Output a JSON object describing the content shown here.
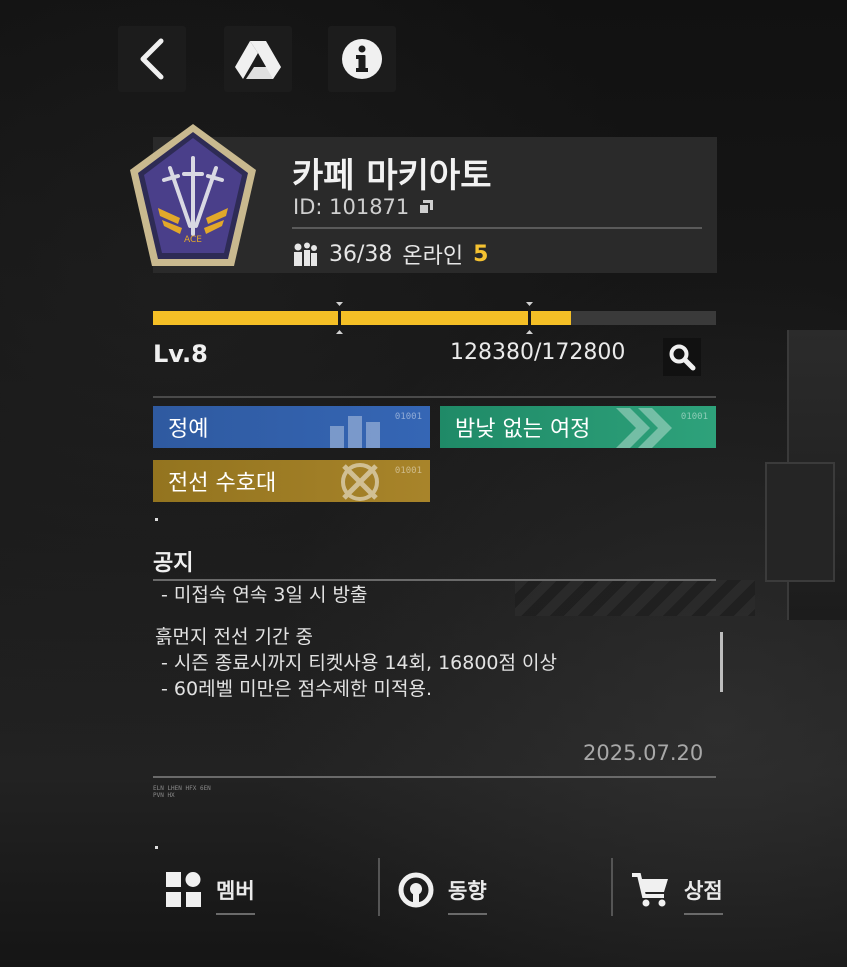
{
  "toolbar": {
    "back_icon": "chevron-left-icon",
    "drive_icon": "google-drive-icon",
    "info_icon": "info-icon"
  },
  "club": {
    "name": "카페 마키아토",
    "id_label": "ID: 101871",
    "members": "36/38",
    "online_label": "온라인",
    "online_count": "5",
    "emblem_text": "ACE"
  },
  "level": {
    "label": "Lv.8",
    "xp_text": "128380/172800",
    "progress": 0.743
  },
  "tags": [
    {
      "label": "정예",
      "code": "01001",
      "color": "#3566b5"
    },
    {
      "label": "밤낮 없는 여정",
      "code": "01001",
      "color": "#2ea27b"
    },
    {
      "label": "전선 수호대",
      "code": "01001",
      "color": "#a8842a"
    }
  ],
  "notice": {
    "title": "공지",
    "lines": [
      " - 미접속 연속 3일 시 방출",
      "",
      "흙먼지 전선 기간 중",
      " - 시즌 종료시까지 티켓사용 14회, 16800점 이상",
      " - 60레벨 미만은 점수제한 미적용."
    ],
    "date": "2025.07.20",
    "tiny_code": "ELN LHEN HFX 6EN\nPVN HX"
  },
  "nav": [
    {
      "label": "멤버",
      "icon": "members-grid-icon"
    },
    {
      "label": "동향",
      "icon": "trend-icon"
    },
    {
      "label": "상점",
      "icon": "shopping-cart-icon"
    }
  ],
  "colors": {
    "accent": "#f4bf26",
    "card": "#2a2a2a",
    "background": "#151515"
  }
}
